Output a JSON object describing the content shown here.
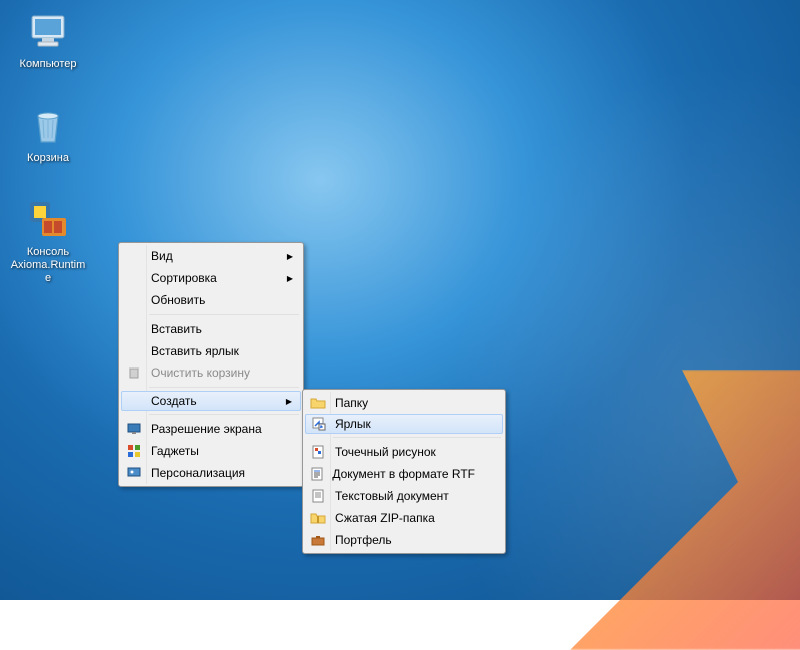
{
  "desktop_icons": [
    {
      "id": "computer",
      "label": "Компьютер"
    },
    {
      "id": "recycle",
      "label": "Корзина"
    },
    {
      "id": "axioma",
      "label": "Консоль Axioma.Runtime"
    }
  ],
  "context_menu": {
    "items": [
      {
        "label": "Вид",
        "has_sub": true
      },
      {
        "label": "Сортировка",
        "has_sub": true
      },
      {
        "label": "Обновить"
      }
    ],
    "items2": [
      {
        "label": "Вставить"
      },
      {
        "label": "Вставить ярлык"
      },
      {
        "label": "Очистить корзину",
        "disabled": true,
        "icon": "trash"
      }
    ],
    "create": {
      "label": "Создать"
    },
    "items3": [
      {
        "label": "Разрешение экрана",
        "icon": "screen"
      },
      {
        "label": "Гаджеты",
        "icon": "gadget"
      },
      {
        "label": "Персонализация",
        "icon": "personalize"
      }
    ]
  },
  "submenu": {
    "items": [
      {
        "label": "Папку",
        "icon": "folder"
      },
      {
        "label": "Ярлык",
        "icon": "shortcut",
        "highlight": true
      }
    ],
    "items2": [
      {
        "label": "Точечный рисунок",
        "icon": "bmp"
      },
      {
        "label": "Документ в формате RTF",
        "icon": "rtf"
      },
      {
        "label": "Текстовый документ",
        "icon": "txt"
      },
      {
        "label": "Сжатая ZIP-папка",
        "icon": "zip"
      },
      {
        "label": "Портфель",
        "icon": "briefcase"
      }
    ]
  }
}
